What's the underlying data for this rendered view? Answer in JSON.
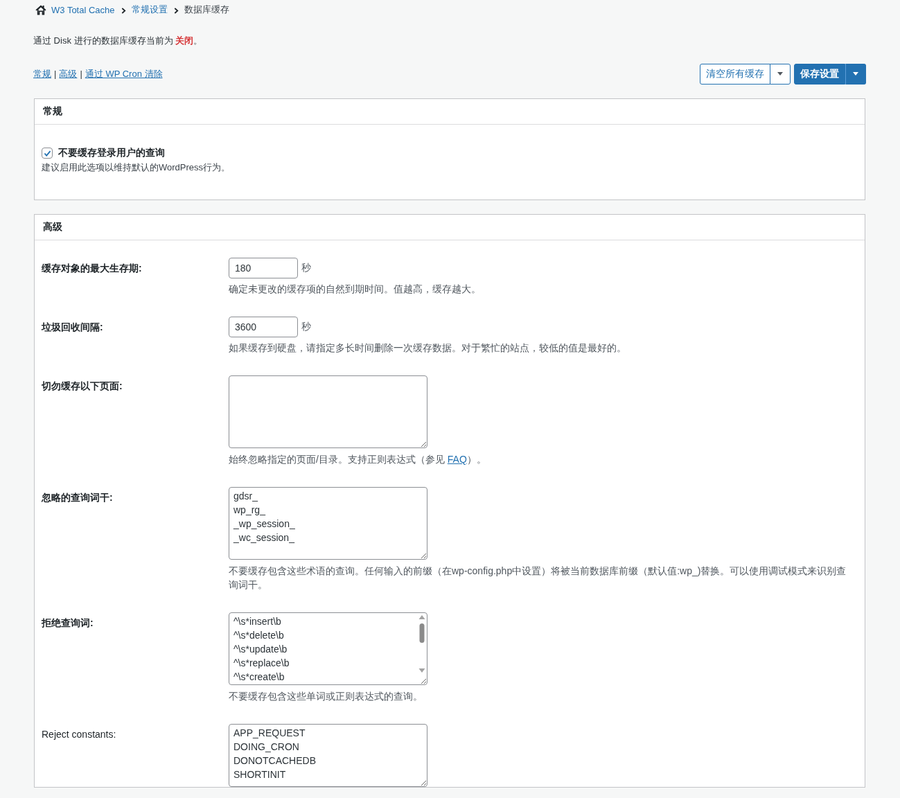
{
  "breadcrumb": {
    "items": [
      {
        "kind": "link",
        "text": "W3 Total Cache"
      },
      {
        "kind": "link",
        "text": "常规设置"
      },
      {
        "kind": "current",
        "text": "数据库缓存"
      }
    ]
  },
  "status_message": "通过 Disk 进行的数据库缓存当前为 **关闭**。",
  "nav_links": [
    {
      "kind": "link",
      "text": "常规"
    },
    {
      "kind": "separator",
      "text": "|"
    },
    {
      "kind": "link",
      "text": "高级"
    },
    {
      "kind": "separator",
      "text": "|"
    },
    {
      "kind": "link",
      "text": "通过 WP Cron 清除"
    }
  ],
  "toolbar_buttons": [
    {
      "kind": "secondary",
      "label": "清空所有缓存",
      "dropdown": true
    },
    {
      "kind": "primary",
      "label": "保存设置",
      "dropdown": true
    }
  ],
  "sections": [
    {
      "kind": "checkboxes",
      "title": "常规",
      "options": [
        {
          "label": "不要缓存登录用户的查询",
          "checked": true,
          "description": "建议启用此选项以维持默认的WordPress行为。"
        }
      ]
    },
    {
      "kind": "form",
      "title": "高级",
      "rows": [
        {
          "kind": "number",
          "label": "缓存对象的最大生存期:",
          "label_bold": true,
          "value": "180",
          "unit": "秒",
          "description": [
            {
              "kind": "text",
              "text": "确定未更改的缓存项的自然到期时间。值越高，缓存越大。"
            }
          ]
        },
        {
          "kind": "number",
          "label": "垃圾回收间隔:",
          "label_bold": true,
          "value": "3600",
          "unit": "秒",
          "description": [
            {
              "kind": "text",
              "text": "如果缓存到硬盘，请指定多长时间删除一次缓存数据。对于繁忙的站点，较低的值是最好的。"
            }
          ]
        },
        {
          "kind": "textarea",
          "label": "切勿缓存以下页面:",
          "label_bold": true,
          "description": [
            {
              "kind": "text",
              "text": "始终忽略指定的页面/目录。支持正则表达式（参见 "
            },
            {
              "kind": "link",
              "text": "FAQ"
            },
            {
              "kind": "text",
              "text": "）。"
            }
          ]
        },
        {
          "kind": "textarea",
          "label": "忽略的查询词干:",
          "label_bold": true,
          "lines": [
            "gdsr_",
            "wp_rg_",
            "_wp_session_",
            "_wc_session_"
          ],
          "description": [
            {
              "kind": "text",
              "text": "不要缓存包含这些术语的查询。任何输入的前缀（在wp-config.php中设置）将被当前数据库前缀（默认值:wp_)替换。可以使用调试模式来识别查询词干。"
            }
          ]
        },
        {
          "kind": "textarea",
          "label": "拒绝查询词:",
          "label_bold": true,
          "scrollbar": true,
          "lines": [
            "^\\s*insert\\b",
            "^\\s*delete\\b",
            "^\\s*update\\b",
            "^\\s*replace\\b",
            "^\\s*create\\b"
          ],
          "description": [
            {
              "kind": "text",
              "text": "不要缓存包含这些单词或正则表达式的查询。"
            }
          ]
        },
        {
          "kind": "textarea",
          "label": "Reject constants:",
          "label_bold": false,
          "lines": [
            "APP_REQUEST",
            "DOING_CRON",
            "DONOTCACHEDB",
            "SHORTINIT"
          ]
        }
      ]
    }
  ]
}
